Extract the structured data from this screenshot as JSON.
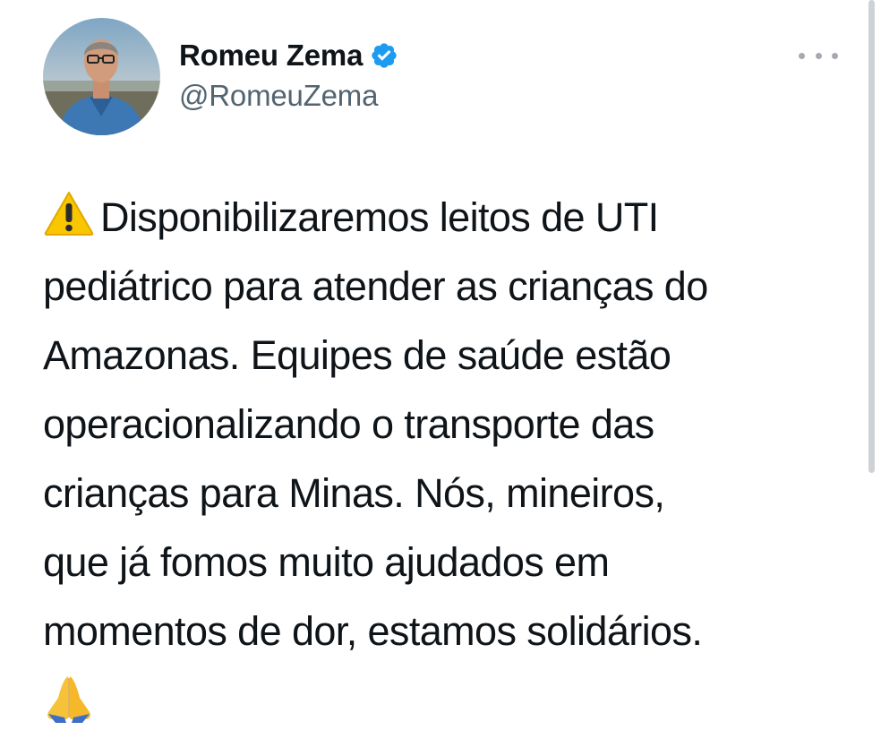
{
  "author": {
    "name": "Romeu Zema",
    "handle": "@RomeuZema",
    "verified": true
  },
  "icons": {
    "verified": "verified-badge-icon",
    "more": "more-options-icon",
    "warning_emoji": "warning-emoji",
    "pray_emoji": "folded-hands-emoji"
  },
  "tweet": {
    "lines": [
      "Disponibilizaremos leitos de UTI",
      "pediátrico para atender as crianças do",
      "Amazonas. Equipes de saúde estão",
      "operacionalizando o transporte das",
      "crianças para Minas. Nós, mineiros,",
      "que já fomos muito ajudados em",
      "momentos de dor, estamos solidários."
    ]
  },
  "colors": {
    "text": "#0f1419",
    "secondary": "#536471",
    "verified_blue": "#1d9bf0"
  }
}
